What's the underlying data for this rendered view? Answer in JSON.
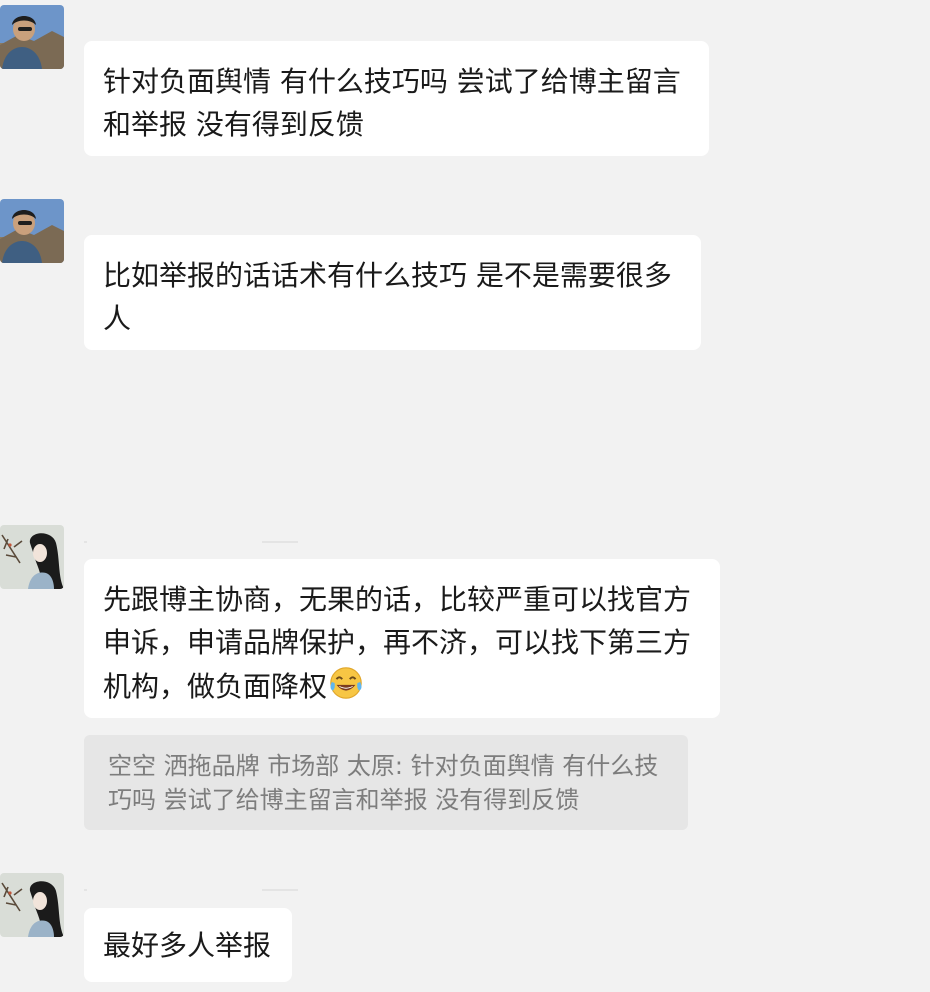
{
  "messages": [
    {
      "text": "针对负面舆情 有什么技巧吗 尝试了给博主留言和举报 没有得到反馈"
    },
    {
      "text": "比如举报的话话术有什么技巧 是不是需要很多人"
    },
    {
      "sender": "        ",
      "text": "先跟博主协商，无果的话，比较严重可以找官方申诉，申请品牌保护，再不济，可以找下第三方机构，做负面降权",
      "emoji": "face-with-tears-of-joy",
      "quote": "空空 洒拖品牌 市场部 太原: 针对负面舆情 有什么技巧吗 尝试了给博主留言和举报 没有得到反馈"
    },
    {
      "sender": "        ",
      "text": "最好多人举报"
    }
  ],
  "colors": {
    "background": "#f2f2f2",
    "bubble": "#ffffff",
    "quote_background": "#e6e6e6",
    "quote_text": "#7d7d7d"
  }
}
